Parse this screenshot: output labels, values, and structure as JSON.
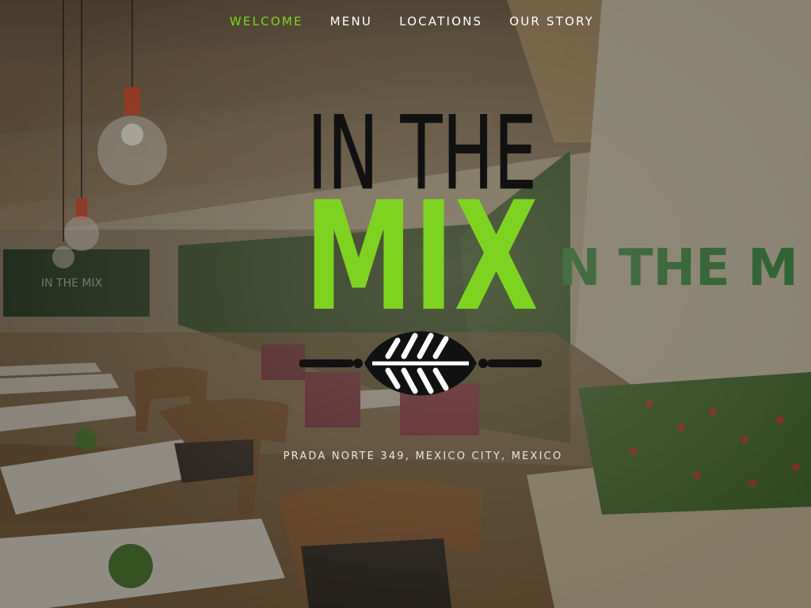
{
  "nav": {
    "items": [
      {
        "label": "WELCOME",
        "active": true
      },
      {
        "label": "MENU",
        "active": false
      },
      {
        "label": "LOCATIONS",
        "active": false
      },
      {
        "label": "OUR STORY",
        "active": false
      }
    ]
  },
  "logo": {
    "line1": "IN THE",
    "line2": "MIX",
    "emblem": "leaf-icon"
  },
  "address": "PRADA NORTE 349, MEXICO CITY, MEXICO",
  "background": {
    "wall_sign": "N THE M",
    "small_sign": "IN THE MIX"
  },
  "colors": {
    "accent": "#7ed321",
    "logo_dark": "#111111",
    "text_light": "#ffffff"
  }
}
